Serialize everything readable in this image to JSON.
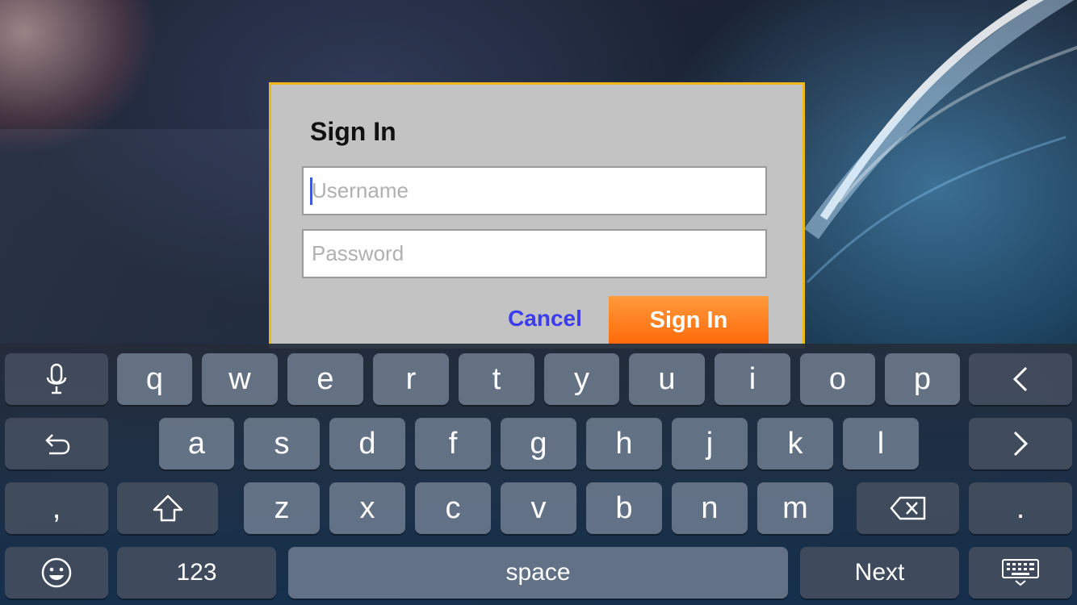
{
  "dialog": {
    "title": "Sign In",
    "username_placeholder": "Username",
    "password_placeholder": "Password",
    "cancel_label": "Cancel",
    "signin_label": "Sign In"
  },
  "keyboard": {
    "row1": [
      "q",
      "w",
      "e",
      "r",
      "t",
      "y",
      "u",
      "i",
      "o",
      "p"
    ],
    "row2": [
      "a",
      "s",
      "d",
      "f",
      "g",
      "h",
      "j",
      "k",
      "l"
    ],
    "row3": [
      "z",
      "x",
      "c",
      "v",
      "b",
      "n",
      "m"
    ],
    "comma": ",",
    "period": ".",
    "numbers_label": "123",
    "space_label": "space",
    "next_label": "Next",
    "icons": {
      "dictation": "microphone-icon",
      "undo": "undo-icon",
      "shift": "shift-icon",
      "emoji": "emoji-icon",
      "previous": "chevron-left-icon",
      "next_field": "chevron-right-icon",
      "delete": "delete-icon",
      "dismiss": "keyboard-dismiss-icon"
    }
  },
  "colors": {
    "dialog_border": "#f2b61b",
    "signin_button": "#ff7a1a",
    "cancel_text": "#3b3cf0",
    "caret": "#3a5bd6"
  }
}
